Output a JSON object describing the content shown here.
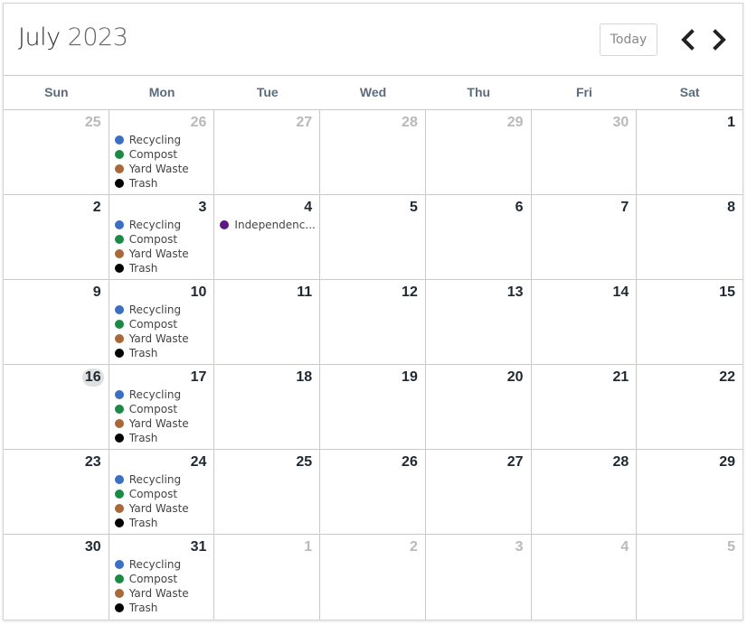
{
  "header": {
    "month": "July",
    "year": "2023",
    "today_label": "Today",
    "prev_icon": "chevron-left-icon",
    "next_icon": "chevron-right-icon"
  },
  "days_of_week": [
    "Sun",
    "Mon",
    "Tue",
    "Wed",
    "Thu",
    "Fri",
    "Sat"
  ],
  "event_types": {
    "recycling": {
      "label": "Recycling",
      "color": "#3a6fc4"
    },
    "compost": {
      "label": "Compost",
      "color": "#1a8a45"
    },
    "yard": {
      "label": "Yard Waste",
      "color": "#a8683a"
    },
    "trash": {
      "label": "Trash",
      "color": "#000000"
    },
    "holiday": {
      "label": "Independenc...",
      "color": "#5b1a82"
    }
  },
  "weeks": [
    [
      {
        "day": "25",
        "other": true,
        "events": []
      },
      {
        "day": "26",
        "other": true,
        "events": [
          "recycling",
          "compost",
          "yard",
          "trash"
        ]
      },
      {
        "day": "27",
        "other": true,
        "events": []
      },
      {
        "day": "28",
        "other": true,
        "events": []
      },
      {
        "day": "29",
        "other": true,
        "events": []
      },
      {
        "day": "30",
        "other": true,
        "events": []
      },
      {
        "day": "1",
        "events": []
      }
    ],
    [
      {
        "day": "2",
        "events": []
      },
      {
        "day": "3",
        "events": [
          "recycling",
          "compost",
          "yard",
          "trash"
        ]
      },
      {
        "day": "4",
        "events": [
          "holiday"
        ]
      },
      {
        "day": "5",
        "events": []
      },
      {
        "day": "6",
        "events": []
      },
      {
        "day": "7",
        "events": []
      },
      {
        "day": "8",
        "events": []
      }
    ],
    [
      {
        "day": "9",
        "events": []
      },
      {
        "day": "10",
        "events": [
          "recycling",
          "compost",
          "yard",
          "trash"
        ]
      },
      {
        "day": "11",
        "events": []
      },
      {
        "day": "12",
        "events": []
      },
      {
        "day": "13",
        "events": []
      },
      {
        "day": "14",
        "events": []
      },
      {
        "day": "15",
        "events": []
      }
    ],
    [
      {
        "day": "16",
        "today": true,
        "events": []
      },
      {
        "day": "17",
        "events": [
          "recycling",
          "compost",
          "yard",
          "trash"
        ]
      },
      {
        "day": "18",
        "events": []
      },
      {
        "day": "19",
        "events": []
      },
      {
        "day": "20",
        "events": []
      },
      {
        "day": "21",
        "events": []
      },
      {
        "day": "22",
        "events": []
      }
    ],
    [
      {
        "day": "23",
        "events": []
      },
      {
        "day": "24",
        "events": [
          "recycling",
          "compost",
          "yard",
          "trash"
        ]
      },
      {
        "day": "25",
        "events": []
      },
      {
        "day": "26",
        "events": []
      },
      {
        "day": "27",
        "events": []
      },
      {
        "day": "28",
        "events": []
      },
      {
        "day": "29",
        "events": []
      }
    ],
    [
      {
        "day": "30",
        "events": []
      },
      {
        "day": "31",
        "events": [
          "recycling",
          "compost",
          "yard",
          "trash"
        ]
      },
      {
        "day": "1",
        "other": true,
        "events": []
      },
      {
        "day": "2",
        "other": true,
        "events": []
      },
      {
        "day": "3",
        "other": true,
        "events": []
      },
      {
        "day": "4",
        "other": true,
        "events": []
      },
      {
        "day": "5",
        "other": true,
        "events": []
      }
    ]
  ]
}
